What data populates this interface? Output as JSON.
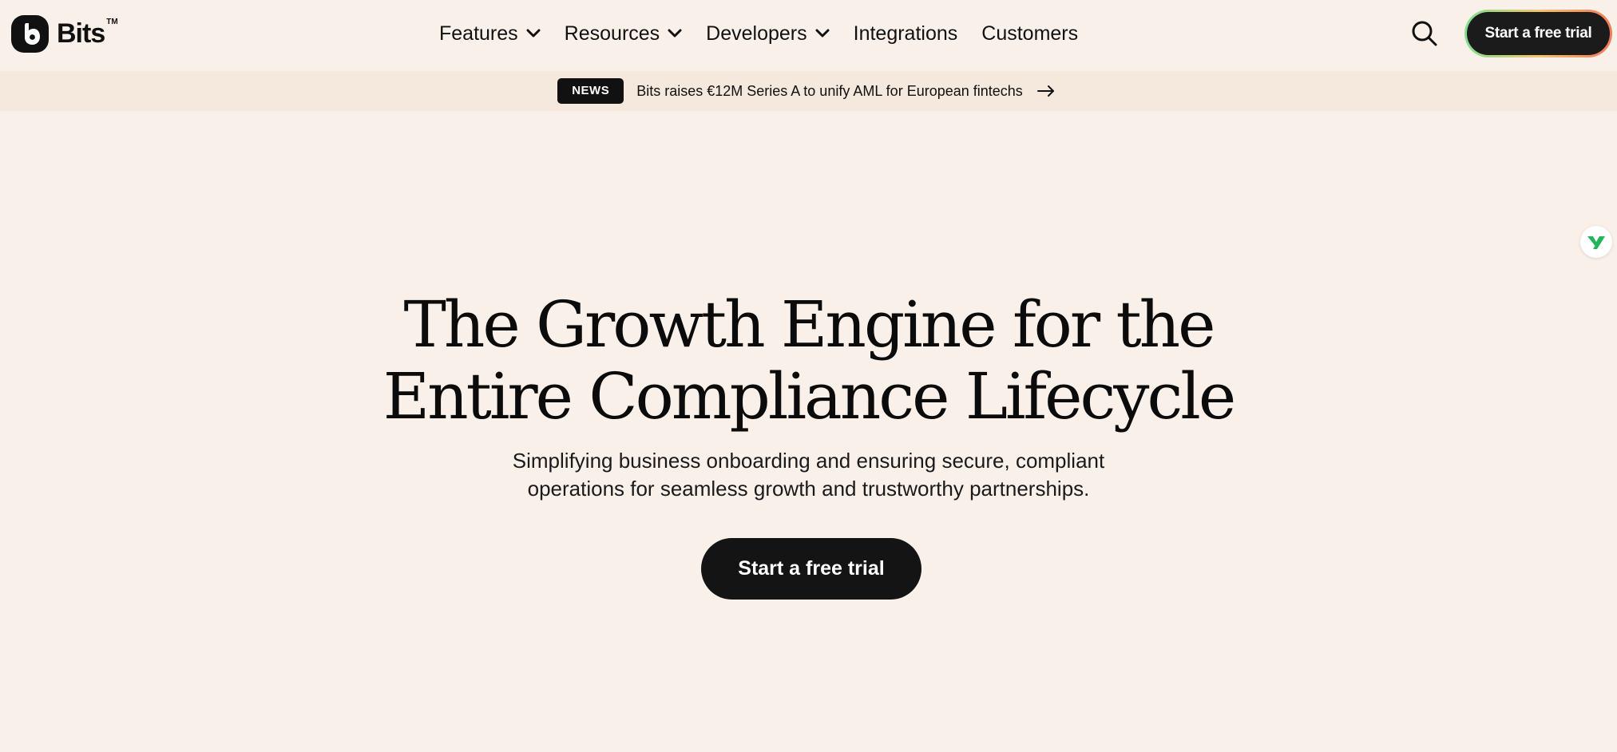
{
  "brand": {
    "name": "Bits",
    "trademark": "TM",
    "logo_icon": "bits-logo-icon"
  },
  "nav": {
    "items": [
      {
        "label": "Features",
        "has_dropdown": true
      },
      {
        "label": "Resources",
        "has_dropdown": true
      },
      {
        "label": "Developers",
        "has_dropdown": true
      },
      {
        "label": "Integrations",
        "has_dropdown": false
      },
      {
        "label": "Customers",
        "has_dropdown": false
      }
    ],
    "search_icon": "search-icon",
    "cta_label": "Start a free trial"
  },
  "news": {
    "badge": "NEWS",
    "text": "Bits raises €12M Series A to unify AML for European fintechs",
    "arrow_icon": "arrow-right-icon"
  },
  "hero": {
    "title_line1": "The Growth Engine for the",
    "title_line2": "Entire Compliance Lifecycle",
    "subtitle_line1": "Simplifying business onboarding and ensuring secure, compliant",
    "subtitle_line2": "operations for seamless growth and trustworthy partnerships.",
    "cta_label": "Start a free trial"
  },
  "widget": {
    "icon": "chat-widget-icon"
  },
  "colors": {
    "background": "#f9f0ea",
    "news_bar": "#f5e8dc",
    "primary": "#141414",
    "widget_accent": "#22b55a"
  }
}
